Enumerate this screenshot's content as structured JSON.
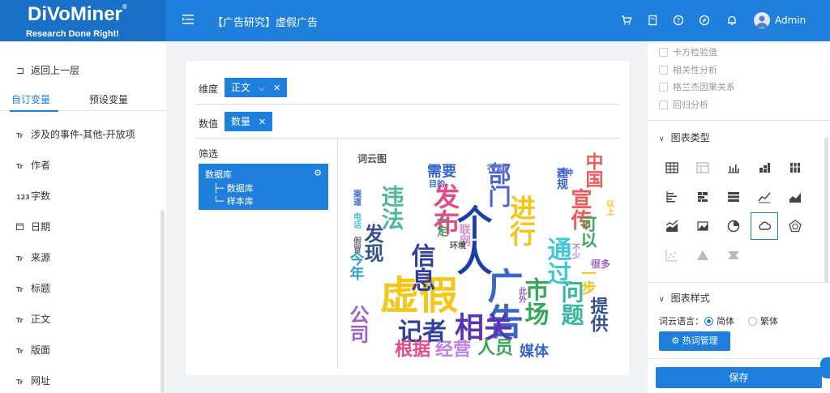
{
  "header": {
    "logo_text": "DiVoMiner",
    "logo_reg": "®",
    "logo_sub": "Research Done Right!",
    "title": "【广告研究】虚假广告",
    "user": "Admin",
    "icons": [
      "cart-icon",
      "document-icon",
      "help-icon",
      "compass-icon",
      "bell-icon"
    ]
  },
  "sidebar": {
    "back_label": "返回上一层",
    "tabs": [
      {
        "label": "自订变量",
        "active": true
      },
      {
        "label": "预设变量",
        "active": false
      }
    ],
    "variables": [
      {
        "type": "Tr",
        "label": "涉及的事件-其他-开放项"
      },
      {
        "type": "Tr",
        "label": "作者"
      },
      {
        "type": "123",
        "label": "字数"
      },
      {
        "type": "cal",
        "label": "日期"
      },
      {
        "type": "Tr",
        "label": "来源"
      },
      {
        "type": "Tr",
        "label": "标题"
      },
      {
        "type": "Tr",
        "label": "正文"
      },
      {
        "type": "Tr",
        "label": "版面"
      },
      {
        "type": "Tr",
        "label": "网址"
      }
    ]
  },
  "center": {
    "dimension_label": "维度",
    "dimension_chip": "正文",
    "value_label": "数值",
    "value_chip": "数量",
    "filter_label": "筛选",
    "filter_root": "数据库",
    "filter_children": [
      "├─ 数据库",
      "└─ 样本库"
    ],
    "cloud_title": "词云图"
  },
  "chart_data": {
    "type": "wordcloud",
    "title": "词云图",
    "words": [
      {
        "text": "虚假",
        "color": "#f5c518",
        "size": 48,
        "vertical": false
      },
      {
        "text": "个人",
        "color": "#1a3fa6",
        "size": 44,
        "vertical": true
      },
      {
        "text": "广告",
        "color": "#3a66c9",
        "size": 44,
        "vertical": true
      },
      {
        "text": "相关",
        "color": "#5b34b5",
        "size": 36,
        "vertical": false
      },
      {
        "text": "记者",
        "color": "#33409b",
        "size": 30,
        "vertical": false
      },
      {
        "text": "发布",
        "color": "#e44a86",
        "size": 32,
        "vertical": true
      },
      {
        "text": "进行",
        "color": "#f5c518",
        "size": 32,
        "vertical": true
      },
      {
        "text": "市场",
        "color": "#3aa65a",
        "size": 30,
        "vertical": true
      },
      {
        "text": "信息",
        "color": "#33409b",
        "size": 30,
        "vertical": true
      },
      {
        "text": "违法",
        "color": "#4fb89a",
        "size": 28,
        "vertical": true
      },
      {
        "text": "通过",
        "color": "#42c7d9",
        "size": 30,
        "vertical": true
      },
      {
        "text": "问题",
        "color": "#39b5a5",
        "size": 28,
        "vertical": true
      },
      {
        "text": "宣传",
        "color": "#ee5a5a",
        "size": 26,
        "vertical": true
      },
      {
        "text": "部门",
        "color": "#4c64d6",
        "size": 28,
        "vertical": true
      },
      {
        "text": "发现",
        "color": "#34508f",
        "size": 24,
        "vertical": true
      },
      {
        "text": "公司",
        "color": "#9c62c9",
        "size": 24,
        "vertical": true
      },
      {
        "text": "根据",
        "color": "#e44a86",
        "size": 22,
        "vertical": false
      },
      {
        "text": "经营",
        "color": "#c080e0",
        "size": 22,
        "vertical": false
      },
      {
        "text": "人员",
        "color": "#3aa65a",
        "size": 22,
        "vertical": false
      },
      {
        "text": "媒体",
        "color": "#3a66c9",
        "size": 18,
        "vertical": false
      },
      {
        "text": "需要",
        "color": "#3a66c9",
        "size": 18,
        "vertical": false
      },
      {
        "text": "中国",
        "color": "#ee5a5a",
        "size": 22,
        "vertical": true
      },
      {
        "text": "可以",
        "color": "#3aa65a",
        "size": 20,
        "vertical": true
      },
      {
        "text": "提供",
        "color": "#34508f",
        "size": 22,
        "vertical": true
      },
      {
        "text": "一步",
        "color": "#f5c518",
        "size": 18,
        "vertical": true
      },
      {
        "text": "今年",
        "color": "#2f9fcf",
        "size": 18,
        "vertical": true
      },
      {
        "text": "一定",
        "color": "#3aa65a",
        "size": 14,
        "vertical": true
      },
      {
        "text": "联网",
        "color": "#d88ed0",
        "size": 14,
        "vertical": true
      },
      {
        "text": "环境",
        "color": "#555555",
        "size": 10,
        "vertical": false
      },
      {
        "text": "行动",
        "color": "#6f7ec9",
        "size": 12,
        "vertical": false
      },
      {
        "text": "这种",
        "color": "#4c64d6",
        "size": 10,
        "vertical": false
      },
      {
        "text": "目的",
        "color": "#3a66c9",
        "size": 10,
        "vertical": false
      },
      {
        "text": "违规",
        "color": "#3a66c9",
        "size": 14,
        "vertical": true
      },
      {
        "text": "很多",
        "color": "#9c62c9",
        "size": 12,
        "vertical": false
      },
      {
        "text": "渠道",
        "color": "#3a66c9",
        "size": 10,
        "vertical": true
      },
      {
        "text": "电话",
        "color": "#42c7d9",
        "size": 10,
        "vertical": true
      },
      {
        "text": "假冒",
        "color": "#777777",
        "size": 10,
        "vertical": true
      },
      {
        "text": "以上",
        "color": "#f5c518",
        "size": 10,
        "vertical": true
      },
      {
        "text": "此外",
        "color": "#9c62c9",
        "size": 10,
        "vertical": true
      },
      {
        "text": "不少",
        "color": "#c080e0",
        "size": 10,
        "vertical": true
      }
    ]
  },
  "right_panel": {
    "analysis_options": [
      "卡方检验值",
      "相关性分析",
      "格兰杰因果关系",
      "回归分析"
    ],
    "chart_type_title": "图表类型",
    "chart_types": [
      "table-icon",
      "pivot-icon",
      "bar-chart-icon",
      "stacked-bar-icon",
      "column-icon",
      "horizontal-bar-icon",
      "stacked-horizontal-icon",
      "list-bar-icon",
      "line-chart-icon",
      "area-chart-icon",
      "combo-chart-icon",
      "heatmap-icon",
      "pie-chart-icon",
      "word-cloud-icon",
      "radar-chart-icon",
      "scatter-icon",
      "triangle-icon",
      "funnel-icon"
    ],
    "selected_chart": "word-cloud-icon",
    "chart_style_title": "图表样式",
    "lang_label": "词云语言：",
    "lang_options": [
      {
        "label": "简体",
        "selected": true
      },
      {
        "label": "繁体",
        "selected": false
      }
    ],
    "hotword_btn": "热词管理",
    "save_btn": "保存",
    "accent_color": "#1f7fdc"
  }
}
